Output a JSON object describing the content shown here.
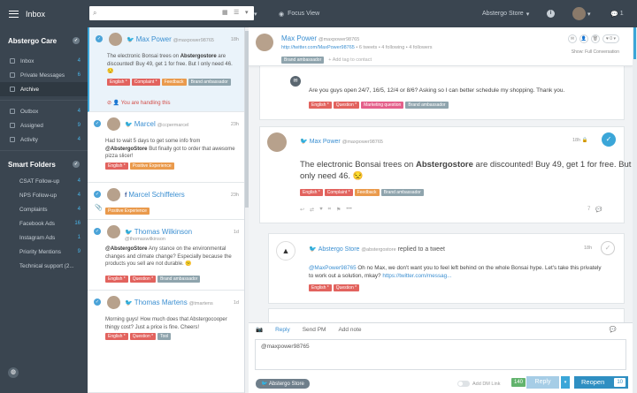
{
  "topbar": {
    "inbox_label": "Inbox",
    "search_placeholder": "",
    "focus_view": "Focus View",
    "store_menu": "Abstergo Store"
  },
  "sidebar": {
    "account": "Abstergo Care",
    "items": [
      {
        "label": "Inbox",
        "count": "4"
      },
      {
        "label": "Private Messages",
        "count": "6"
      },
      {
        "label": "Archive",
        "count": ""
      },
      {
        "label": "Outbox",
        "count": "4"
      },
      {
        "label": "Assigned",
        "count": "9"
      },
      {
        "label": "Activity",
        "count": "4"
      }
    ],
    "smart_folders_title": "Smart Folders",
    "folders": [
      {
        "label": "CSAT Follow-up",
        "count": "4"
      },
      {
        "label": "NPS Follow-up",
        "count": "4"
      },
      {
        "label": "Complaints",
        "count": "4"
      },
      {
        "label": "Facebook Ads",
        "count": "16"
      },
      {
        "label": "Instagram Ads",
        "count": "1"
      },
      {
        "label": "Priority Mentions",
        "count": "9"
      },
      {
        "label": "Technical support (2...",
        "count": ""
      }
    ]
  },
  "list": [
    {
      "name": "Max Power",
      "handle": "@maxpower98765",
      "time": "18h",
      "text_pre": "The electronic Bonsai trees on ",
      "text_bold": "Abstergostore",
      "text_post": " are discounted! Buy 49, get 1 for free. But I only need 46. 😒",
      "tags": [
        "English *",
        "Complaint *",
        "Feedback",
        "Brand ambassador"
      ],
      "handling": "You are handling this"
    },
    {
      "name": "Marcel",
      "handle": "@ccpermarcel",
      "time": "23h",
      "text_pre": "Had to wait 5 days to get some info from ",
      "text_bold": "@AbstergoStore",
      "text_post": " But finally got to order that awesome pizza slicer!",
      "tags": [
        "English *",
        "Positive Experience"
      ]
    },
    {
      "name": "Marcel Schiffelers",
      "time": "23h",
      "tags": [
        "Positive Experience"
      ]
    },
    {
      "name": "Thomas Wilkinson",
      "handle": "@thomaswilkinson",
      "time": "1d",
      "text_pre": "",
      "text_bold": "@AbstergoStore",
      "text_post": " Any stance on the environmental changes and climate change? Especially because the products you sell are not durable. 😕",
      "tags": [
        "English *",
        "Question *",
        "Brand ambassador"
      ]
    },
    {
      "name": "Thomas Martens",
      "handle": "@tmartens",
      "time": "1d",
      "text_pre": "Morning guys! How much does that Abstergocooper thingy cost? Just a price is fine. Cheers!",
      "text_bold": "",
      "text_post": "",
      "tags": [
        "English *",
        "Question *",
        "Tool"
      ]
    }
  ],
  "contact": {
    "name": "Max Power",
    "handle": "@maxpower98765",
    "url": "http://twitter.com/MaxPower98765",
    "stats": "• 6 tweets • 4 following • 4 followers",
    "tag": "Brand ambassador",
    "add_tag": "Add tag to contact",
    "show": "Show: Full Conversation"
  },
  "conversation": {
    "msg1": {
      "text": "Are you guys open 24/7, 16/5, 12/4 or 8/6? Asking so I can better schedule my shopping. Thank you.",
      "tags": [
        "English *",
        "Question *",
        "Marketing question",
        "Brand ambassador"
      ]
    },
    "msg2": {
      "name": "Max Power",
      "handle": "@maxpower98765",
      "time": "18h",
      "text_pre": "The electronic Bonsai trees on ",
      "text_bold": "Abstergostore",
      "text_post": " are discounted! Buy 49, get 1 for free. But I",
      "text_line2": "only need 46. 😒",
      "tags": [
        "English *",
        "Complaint *",
        "Feedback",
        "Brand ambassador"
      ],
      "reply_count": "7"
    },
    "msg3": {
      "name": "Abstergo Store",
      "handle": "@abstergostore",
      "action": "replied to a tweet",
      "time": "18h",
      "text_bold": "@MaxPower98765",
      "text": " Oh no Max, we don't want you to feel left behind on the whole Bonsai hype. Let's take this privately",
      "text_line2_pre": "to work out a solution, mkay? ",
      "text_link": "https://twitter.com/messag...",
      "tags": [
        "English *",
        "Question *"
      ]
    }
  },
  "reply": {
    "tabs": [
      "Reply",
      "Send PM",
      "Add note"
    ],
    "input_value": "@maxpower98765",
    "account": "Abstergo Store",
    "dm_link": "Add DM Link",
    "char_count": "140",
    "reply_button": "Reply",
    "reopen_button": "Reopen",
    "reopen_count": "10"
  },
  "colors": {
    "accent": "#3ba6d8",
    "sidebar": "#3a4550"
  }
}
